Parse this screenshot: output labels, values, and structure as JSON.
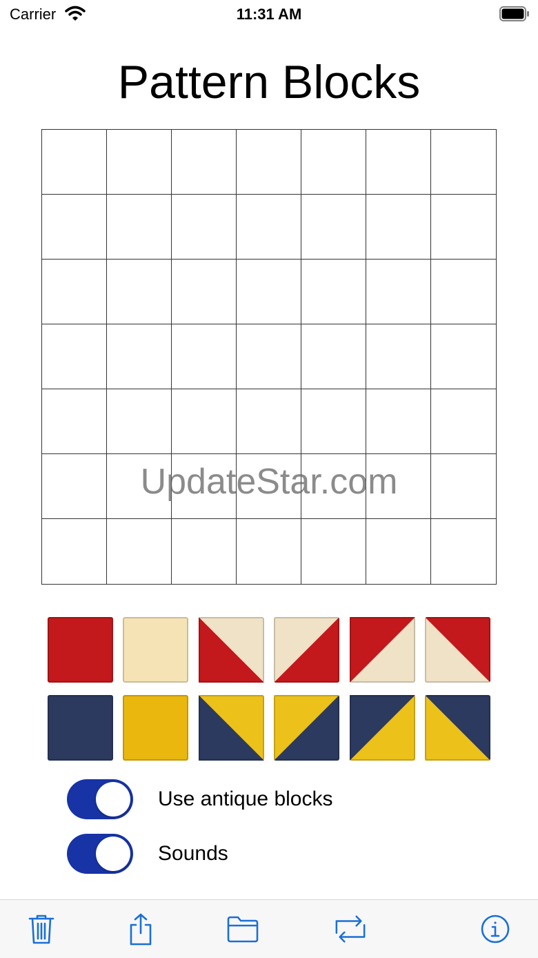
{
  "status": {
    "carrier": "Carrier",
    "time": "11:31 AM"
  },
  "title": "Pattern Blocks",
  "watermark": "UpdateStar.com",
  "grid": {
    "rows": 7,
    "cols": 7
  },
  "palette": {
    "rows": [
      [
        {
          "name": "red-square-block",
          "kind": "solid",
          "a": "#c3181c"
        },
        {
          "name": "cream-square-block",
          "kind": "solid",
          "a": "#f5e3b6"
        },
        {
          "name": "red-cream-diagonal-block-1",
          "kind": "tl-br",
          "a": "#c3181c",
          "b": "#f0e2c6"
        },
        {
          "name": "red-cream-diagonal-block-2",
          "kind": "tr-bl",
          "a": "#f0e2c6",
          "b": "#c3181c"
        },
        {
          "name": "red-cream-diagonal-block-3",
          "kind": "tr-bl",
          "a": "#c3181c",
          "b": "#f0e2c6"
        },
        {
          "name": "red-cream-diagonal-block-4",
          "kind": "tl-br",
          "a": "#f0e2c6",
          "b": "#c3181c"
        }
      ],
      [
        {
          "name": "navy-square-block",
          "kind": "solid",
          "a": "#2c3a5f"
        },
        {
          "name": "yellow-square-block",
          "kind": "solid",
          "a": "#eab70f"
        },
        {
          "name": "navy-yellow-diagonal-block-1",
          "kind": "tl-br",
          "a": "#2c3a5f",
          "b": "#ecc11a"
        },
        {
          "name": "navy-yellow-diagonal-block-2",
          "kind": "tr-bl",
          "a": "#ecc11a",
          "b": "#2c3a5f"
        },
        {
          "name": "navy-yellow-diagonal-block-3",
          "kind": "tr-bl",
          "a": "#2c3a5f",
          "b": "#ecc11a"
        },
        {
          "name": "navy-yellow-diagonal-block-4",
          "kind": "tl-br",
          "a": "#ecc11a",
          "b": "#2c3a5f"
        }
      ]
    ]
  },
  "toggles": {
    "antique": {
      "label": "Use antique blocks",
      "on": true
    },
    "sounds": {
      "label": "Sounds",
      "on": true
    }
  },
  "toolbar": {
    "tint": "#1a6fd6",
    "icons": [
      "trash-icon",
      "share-icon",
      "folder-icon",
      "repeat-icon",
      "info-icon"
    ]
  },
  "colors": {
    "toggle_on": "#1733a6",
    "grid_line": "#333333"
  }
}
